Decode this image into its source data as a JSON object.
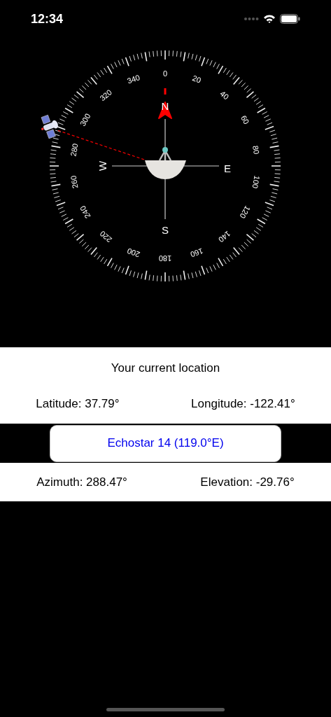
{
  "status_bar": {
    "time": "12:34"
  },
  "compass": {
    "degree_labels": [
      "0",
      "20",
      "40",
      "60",
      "80",
      "100",
      "120",
      "140",
      "160",
      "180",
      "200",
      "220",
      "240",
      "260",
      "280",
      "300",
      "320",
      "340"
    ],
    "cardinals": [
      "N",
      "E",
      "S",
      "W"
    ]
  },
  "location": {
    "title": "Your current location",
    "latitude": "Latitude: 37.79°",
    "longitude": "Longitude: -122.41°"
  },
  "satellite_button": {
    "label": "Echostar 14 (119.0°E)"
  },
  "pointing": {
    "azimuth": "Azimuth: 288.47°",
    "elevation": "Elevation: -29.76°"
  }
}
